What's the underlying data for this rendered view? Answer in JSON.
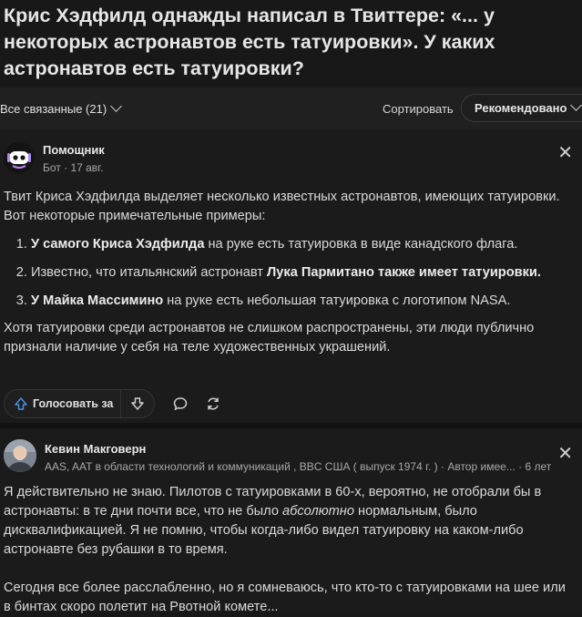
{
  "question": {
    "title": "Крис Хэдфилд однажды написал в Твиттере: «... у некоторых астронавтов есть татуировки». У каких астронавтов есть татуировки?"
  },
  "toolbar": {
    "filter_label": "Все связанные (21)",
    "sort_label": "Сортировать",
    "sort_value": "Рекомендовано"
  },
  "answer1": {
    "author_name": "Помощник",
    "author_meta": "Бот · 17 авг.",
    "intro": "Твит Криса Хэдфилда выделяет несколько известных астронавтов, имеющих татуировки. Вот некоторые примечательные примеры:",
    "items": [
      {
        "bold": "У самого Криса Хэдфилда",
        "rest": " на руке есть татуировка в виде канадского флага."
      },
      {
        "pre": "Известно, что итальянский астронавт ",
        "bold": "Лука Пармитано также имеет татуировки."
      },
      {
        "bold": "У Майка Массимино",
        "rest": " на руке есть небольшая татуировка с логотипом NASA."
      }
    ],
    "outro": "Хотя татуировки среди астронавтов не слишком распространены, эти люди публично признали наличие у себя на теле художественных украшений.",
    "upvote_label": "Голосовать за"
  },
  "answer2": {
    "author_name": "Кевин Макговерн",
    "author_meta": "AAS, AAT в области технологий и коммуникаций , BBC США ( выпуск 1974 г. ) · Автор имее... · 6 лет",
    "para1_pre": "Я действительно не знаю. Пилотов с татуировками в 60-х, вероятно, не отобрали бы в астронавты: в те дни почти все, что не было ",
    "para1_em": "абсолютно",
    "para1_post": " нормальным, было дисквалификацией. Я не помню, чтобы когда-либо видел татуировку на каком-либо астронавте без рубашки в то время.",
    "para2": "Сегодня все более расслабленно, но я сомневаюсь, что кто-то с татуировками на шее или в бинтах скоро полетит на Рвотной комете..."
  },
  "icons": {
    "close": "close-icon",
    "chevron": "chevron-down-icon",
    "upvote": "arrow-up-icon",
    "downvote": "arrow-down-icon",
    "comment": "comment-icon",
    "share": "share-icon"
  },
  "colors": {
    "background": "#181818",
    "upvote_accent": "#4a90e2"
  }
}
